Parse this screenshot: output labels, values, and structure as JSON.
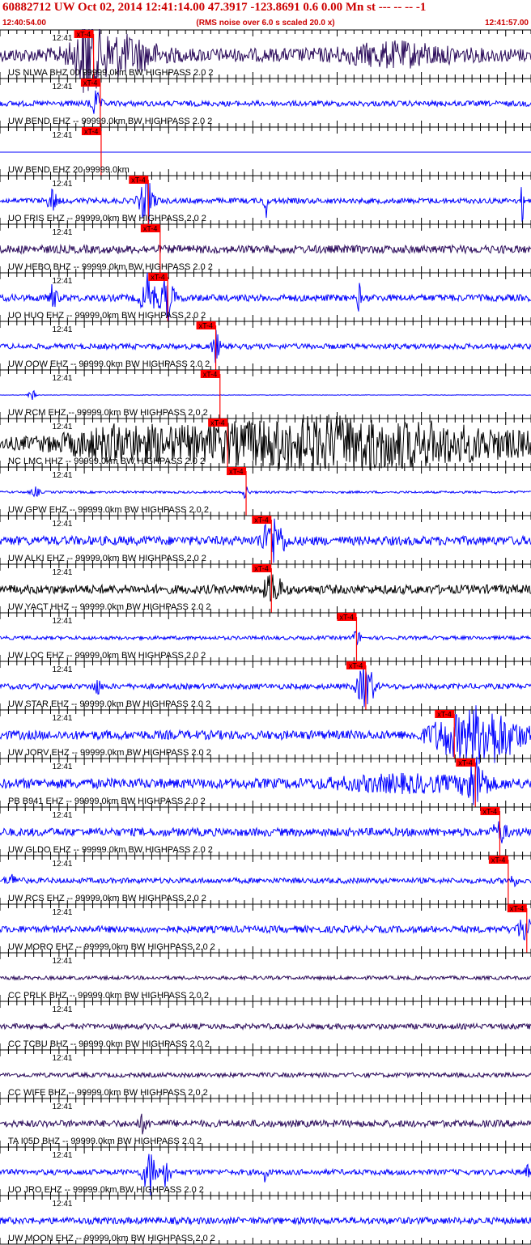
{
  "header": {
    "title": "60882712 UW Oct 02, 2014 12:41:14.00   47.3917 -123.8691  0.6 0.00 Mn st --- -- --  -1",
    "start_time": "12:40:54.00",
    "subtitle": "(RMS noise over 6.0 s scaled 20.0 x)",
    "end_time": "12:41:57.00"
  },
  "chart_data": {
    "type": "line",
    "title": "60882712 UW Oct 02, 2014 12:41:14.00   47.3917 -123.8691  0.6 0.00 Mn st --- -- --  -1",
    "x_start": "12:40:54.00",
    "x_end": "12:41:57.00",
    "x_unit": "seconds after 12:40:54",
    "x_range": [
      0,
      63
    ],
    "tick_label": "12:41",
    "tick_label_s": 6,
    "pick_label": "xT-4",
    "colors": {
      "text": "#cc0000",
      "pick": "#ff0000",
      "blue": "#0000ff",
      "purple": "#2a0a5a",
      "black": "#000000"
    },
    "traces": [
      {
        "label": "US NLWA BHZ 00 99999.0km BW  HIGHPASS  2.0  2",
        "color": "purple",
        "pick_s": 11.1,
        "amp": 0.3,
        "bursts": [
          [
            10.3,
            1.0,
            1.2
          ],
          [
            11.5,
            3.0,
            0.8
          ],
          [
            16,
            3,
            0.5
          ],
          [
            47,
            6,
            0.35
          ]
        ]
      },
      {
        "label": "UW BEND EHZ -- 99999.0km BW  HIGHPASS  2.0  2",
        "color": "blue",
        "pick_s": 11.9,
        "amp": 0.12,
        "bursts": [
          [
            11.3,
            0.6,
            0.5
          ]
        ]
      },
      {
        "label": "UW BEND EHZ 20 99999.0km",
        "color": "blue",
        "pick_s": 12.0,
        "amp": 0.0,
        "bursts": []
      },
      {
        "label": "UO FRIS EHZ -- 99999.0km BW  HIGHPASS  2.0  2",
        "color": "blue",
        "pick_s": 17.6,
        "amp": 0.12,
        "bursts": [
          [
            17.4,
            0.8,
            1.0
          ],
          [
            6.2,
            0.5,
            0.5
          ],
          [
            31.5,
            0.2,
            0.9
          ],
          [
            62,
            0.2,
            0.9
          ]
        ]
      },
      {
        "label": "UW HEBO BHZ -- 99999.0km BW  HIGHPASS  2.0  2",
        "color": "purple",
        "pick_s": 19.0,
        "amp": 0.18,
        "bursts": []
      },
      {
        "label": "UO HUO EHZ -- 99999.0km BW  HIGHPASS  2.0  2",
        "color": "blue",
        "pick_s": 19.9,
        "amp": 0.15,
        "bursts": [
          [
            17.6,
            0.8,
            1.0
          ],
          [
            19.8,
            0.8,
            0.9
          ],
          [
            6.2,
            0.5,
            0.5
          ],
          [
            42.6,
            0.2,
            0.6
          ]
        ]
      },
      {
        "label": "UW OOW EHZ -- 99999.0km BW  HIGHPASS  2.0  2",
        "color": "blue",
        "pick_s": 25.6,
        "amp": 0.12,
        "bursts": [
          [
            25.6,
            0.4,
            0.7
          ]
        ]
      },
      {
        "label": "UW RCM EHZ -- 99999.0km BW  HIGHPASS  2.0  2",
        "color": "blue",
        "pick_s": 26.1,
        "amp": 0.01,
        "bursts": [
          [
            3.8,
            0.4,
            0.25
          ]
        ]
      },
      {
        "label": "NC LMC HHZ -- 99999.0km BW  HIGHPASS  2.0  2",
        "color": "black",
        "pick_s": 27.0,
        "amp": 0.25,
        "bursts": [
          [
            40,
            22,
            1.0
          ],
          [
            14,
            6,
            0.4
          ]
        ]
      },
      {
        "label": "UW GPW EHZ -- 99999.0km BW  HIGHPASS  2.0  2",
        "color": "blue",
        "pick_s": 29.2,
        "amp": 0.05,
        "bursts": [
          [
            29.2,
            0.3,
            0.35
          ],
          [
            4.2,
            0.5,
            0.2
          ]
        ]
      },
      {
        "label": "UW ALKI EHZ -- 99999.0km BW  HIGHPASS  2.0  2",
        "color": "blue",
        "pick_s": 32.2,
        "amp": 0.2,
        "bursts": [
          [
            32.4,
            1.2,
            1.0
          ]
        ]
      },
      {
        "label": "UW YACT HHZ -- 99999.0km BW  HIGHPASS  2.0  2",
        "color": "black",
        "pick_s": 32.2,
        "amp": 0.2,
        "bursts": [
          [
            32.4,
            1.0,
            0.6
          ]
        ]
      },
      {
        "label": "UW LOC EHZ -- 99999.0km BW  HIGHPASS  2.0  2",
        "color": "blue",
        "pick_s": 42.3,
        "amp": 0.08,
        "bursts": [
          [
            42.3,
            0.5,
            0.3
          ]
        ]
      },
      {
        "label": "UW STAR EHZ -- 99999.0km BW  HIGHPASS  2.0  2",
        "color": "blue",
        "pick_s": 43.4,
        "amp": 0.12,
        "bursts": [
          [
            43.4,
            0.9,
            1.1
          ],
          [
            11.5,
            0.5,
            0.3
          ]
        ]
      },
      {
        "label": "UW JORV EHZ -- 99999.0km BW  HIGHPASS  2.0  2",
        "color": "blue",
        "pick_s": 53.9,
        "amp": 0.2,
        "bursts": [
          [
            57.5,
            4.0,
            1.2
          ],
          [
            52.5,
            2.0,
            0.4
          ]
        ]
      },
      {
        "label": "PB B941 EHZ -- 99999.0km BW  HIGHPASS  2.0  2",
        "color": "blue",
        "pick_s": 56.4,
        "amp": 0.22,
        "bursts": [
          [
            56.4,
            1.2,
            1.0
          ],
          [
            48,
            8,
            0.25
          ]
        ]
      },
      {
        "label": "UW GLDO EHZ -- 99999.0km BW  HIGHPASS  2.0  2",
        "color": "blue",
        "pick_s": 59.3,
        "amp": 0.18,
        "bursts": [
          [
            59.3,
            0.8,
            0.4
          ]
        ]
      },
      {
        "label": "UW RCS EHZ -- 99999.0km BW  HIGHPASS  2.0  2",
        "color": "blue",
        "pick_s": 60.3,
        "amp": 0.12,
        "bursts": [
          [
            60.8,
            0.5,
            0.2
          ],
          [
            1.5,
            0.8,
            0.2
          ]
        ]
      },
      {
        "label": "UW MORO EHZ -- 99999.0km BW  HIGHPASS  2.0  2",
        "color": "blue",
        "pick_s": 62.5,
        "amp": 0.15,
        "bursts": [
          [
            62.5,
            1.0,
            0.6
          ]
        ]
      },
      {
        "label": "CC PRLK BHZ -- 99999.0km BW  HIGHPASS  2.0  2",
        "color": "purple",
        "amp": 0.08,
        "bursts": []
      },
      {
        "label": "CC TCBU BHZ -- 99999.0km BW  HIGHPASS  2.0  2",
        "color": "purple",
        "amp": 0.12,
        "bursts": []
      },
      {
        "label": "CC WIFE BHZ -- 99999.0km BW  HIGHPASS  2.0  2",
        "color": "purple",
        "amp": 0.1,
        "bursts": []
      },
      {
        "label": "TA I05D BHZ -- 99999.0km BW  HIGHPASS  2.0  2",
        "color": "purple",
        "amp": 0.15,
        "bursts": [
          [
            17,
            0.5,
            0.35
          ]
        ]
      },
      {
        "label": "UO JRO EHZ -- 99999.0km BW  HIGHPASS  2.0  2",
        "color": "blue",
        "amp": 0.12,
        "bursts": [
          [
            17.8,
            0.8,
            1.0
          ],
          [
            19.8,
            0.4,
            0.7
          ],
          [
            31.5,
            0.2,
            0.6
          ],
          [
            62.5,
            0.2,
            0.6
          ]
        ]
      },
      {
        "label": "UW MOON EHZ -- 99999.0km BW  HIGHPASS  2.0  2",
        "color": "blue",
        "amp": 0.15,
        "bursts": []
      }
    ]
  }
}
